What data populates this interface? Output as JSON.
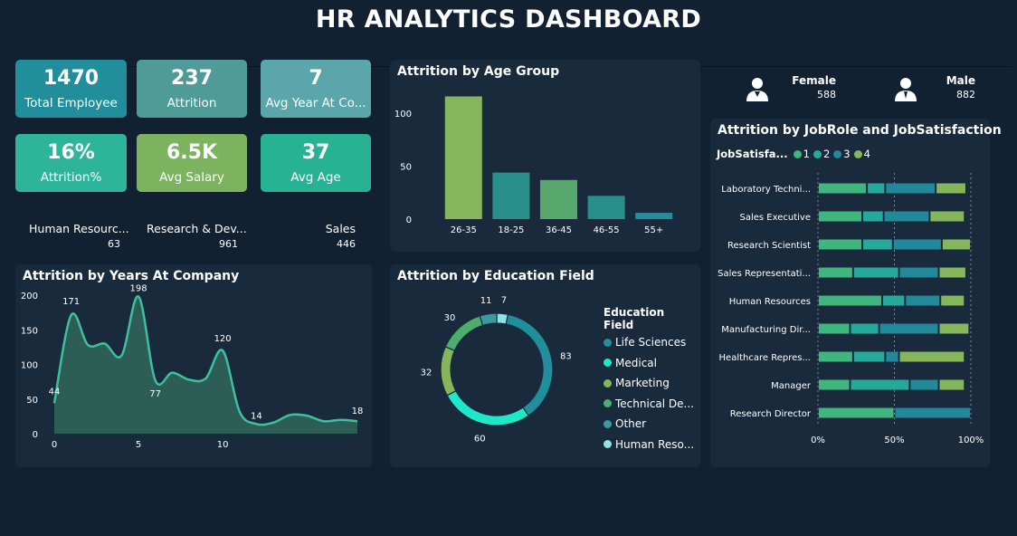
{
  "header": {
    "title": "HR ANALYTICS DASHBOARD"
  },
  "kpis": [
    {
      "value": "1470",
      "label": "Total Employee",
      "color": "#218e9c"
    },
    {
      "value": "237",
      "label": "Attrition",
      "color": "#4e9b97"
    },
    {
      "value": "7",
      "label": "Avg Year At Co...",
      "color": "#5aa6aa"
    },
    {
      "value": "16%",
      "label": "Attrition%",
      "color": "#2eb49a"
    },
    {
      "value": "6.5K",
      "label": "Avg Salary",
      "color": "#7bb35e"
    },
    {
      "value": "37",
      "label": "Avg Age",
      "color": "#28b294"
    }
  ],
  "departments": [
    {
      "name": "Human Resourc...",
      "count": "63"
    },
    {
      "name": "Research & Dev...",
      "count": "961"
    },
    {
      "name": "Sales",
      "count": "446"
    }
  ],
  "gender": {
    "female": {
      "label": "Female",
      "count": "588"
    },
    "male": {
      "label": "Male",
      "count": "882"
    }
  },
  "colors": {
    "green": "#86b65c",
    "teal": "#2a8f8a",
    "mid_green": "#58a86e",
    "mint": "#00e6c3",
    "blue_teal": "#218e9c",
    "light_teal": "#7fd9d6",
    "area": "#2d5e56",
    "area_line": "#3fbf9f"
  },
  "age_chart": {
    "title": "Attrition by Age Group",
    "chart_data": {
      "type": "bar",
      "categories": [
        "26-35",
        "18-25",
        "36-45",
        "46-55",
        "55+"
      ],
      "values": [
        116,
        44,
        37,
        22,
        6
      ],
      "bar_colors": [
        "#86b65c",
        "#2a8f8a",
        "#58a86e",
        "#2a8f8a",
        "#218e9c"
      ],
      "y_ticks": [
        "0",
        "50",
        "100"
      ],
      "ylim": [
        0,
        125
      ]
    }
  },
  "years_chart": {
    "title": "Attrition by Years At Company",
    "chart_data": {
      "type": "area",
      "x": [
        0,
        1,
        2,
        3,
        4,
        5,
        6,
        7,
        8,
        9,
        10,
        11,
        12,
        13,
        14,
        15,
        16,
        17,
        18
      ],
      "values": [
        44,
        171,
        128,
        130,
        113,
        198,
        77,
        88,
        78,
        80,
        120,
        32,
        14,
        16,
        27,
        26,
        18,
        20,
        18
      ],
      "data_labels": [
        {
          "x": 0,
          "text": "44"
        },
        {
          "x": 1,
          "text": "171"
        },
        {
          "x": 5,
          "text": "198"
        },
        {
          "x": 6,
          "text": "77"
        },
        {
          "x": 10,
          "text": "120"
        },
        {
          "x": 12,
          "text": "14"
        },
        {
          "x": 18,
          "text": "18"
        }
      ],
      "y_ticks": [
        "0",
        "50",
        "100",
        "150",
        "200"
      ],
      "x_ticks": [
        "0",
        "5",
        "10"
      ],
      "ylim": [
        0,
        200
      ],
      "xlim": [
        0,
        18
      ]
    }
  },
  "education_chart": {
    "title": "Attrition by Education Field",
    "legend_title": "Education Field",
    "chart_data": {
      "type": "pie",
      "categories": [
        "Life Sciences",
        "Medical",
        "Marketing",
        "Technical De...",
        "Other",
        "Human Reso..."
      ],
      "values": [
        83,
        60,
        32,
        30,
        11,
        7
      ],
      "slice_colors": [
        "#218e9c",
        "#1de9c8",
        "#86b65c",
        "#4cae6e",
        "#3a9aa0",
        "#8fe3e0"
      ],
      "data_labels": [
        "83",
        "60",
        "32",
        "30",
        "11",
        "7"
      ]
    }
  },
  "jobrole_chart": {
    "title": "Attrition by JobRole and JobSatisfaction",
    "legend_title": "JobSatisfa...",
    "chart_data": {
      "type": "bar",
      "stacked": "100%",
      "series_names": [
        "1",
        "2",
        "3",
        "4"
      ],
      "series_colors": [
        "#3fb67d",
        "#26a99a",
        "#22899a",
        "#86b65c"
      ],
      "categories": [
        "Laboratory Techni...",
        "Sales Executive",
        "Research Scientist",
        "Sales Representati...",
        "Human Resources",
        "Manufacturing Dir...",
        "Healthcare Repres...",
        "Manager",
        "Research Director"
      ],
      "percentages": [
        [
          32,
          12,
          33,
          20
        ],
        [
          29,
          14,
          30,
          23
        ],
        [
          29,
          20,
          32,
          19
        ],
        [
          23,
          30,
          26,
          18
        ],
        [
          42,
          15,
          23,
          16
        ],
        [
          21,
          19,
          39,
          20
        ],
        [
          23,
          21,
          9,
          43
        ],
        [
          21,
          39,
          19,
          17
        ],
        [
          50,
          0,
          50,
          0
        ]
      ],
      "x_ticks": [
        "0%",
        "50%",
        "100%"
      ]
    }
  }
}
